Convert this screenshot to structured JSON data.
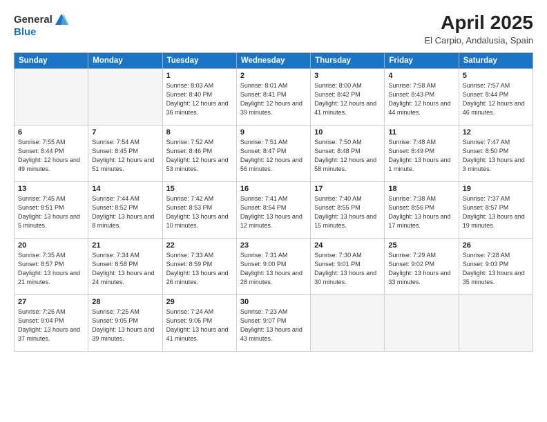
{
  "header": {
    "logo_general": "General",
    "logo_blue": "Blue",
    "title": "April 2025",
    "subtitle": "El Carpio, Andalusia, Spain"
  },
  "weekdays": [
    "Sunday",
    "Monday",
    "Tuesday",
    "Wednesday",
    "Thursday",
    "Friday",
    "Saturday"
  ],
  "weeks": [
    [
      {
        "day": "",
        "info": ""
      },
      {
        "day": "",
        "info": ""
      },
      {
        "day": "1",
        "info": "Sunrise: 8:03 AM\nSunset: 8:40 PM\nDaylight: 12 hours and 36 minutes."
      },
      {
        "day": "2",
        "info": "Sunrise: 8:01 AM\nSunset: 8:41 PM\nDaylight: 12 hours and 39 minutes."
      },
      {
        "day": "3",
        "info": "Sunrise: 8:00 AM\nSunset: 8:42 PM\nDaylight: 12 hours and 41 minutes."
      },
      {
        "day": "4",
        "info": "Sunrise: 7:58 AM\nSunset: 8:43 PM\nDaylight: 12 hours and 44 minutes."
      },
      {
        "day": "5",
        "info": "Sunrise: 7:57 AM\nSunset: 8:44 PM\nDaylight: 12 hours and 46 minutes."
      }
    ],
    [
      {
        "day": "6",
        "info": "Sunrise: 7:55 AM\nSunset: 8:44 PM\nDaylight: 12 hours and 49 minutes."
      },
      {
        "day": "7",
        "info": "Sunrise: 7:54 AM\nSunset: 8:45 PM\nDaylight: 12 hours and 51 minutes."
      },
      {
        "day": "8",
        "info": "Sunrise: 7:52 AM\nSunset: 8:46 PM\nDaylight: 12 hours and 53 minutes."
      },
      {
        "day": "9",
        "info": "Sunrise: 7:51 AM\nSunset: 8:47 PM\nDaylight: 12 hours and 56 minutes."
      },
      {
        "day": "10",
        "info": "Sunrise: 7:50 AM\nSunset: 8:48 PM\nDaylight: 12 hours and 58 minutes."
      },
      {
        "day": "11",
        "info": "Sunrise: 7:48 AM\nSunset: 8:49 PM\nDaylight: 13 hours and 1 minute."
      },
      {
        "day": "12",
        "info": "Sunrise: 7:47 AM\nSunset: 8:50 PM\nDaylight: 13 hours and 3 minutes."
      }
    ],
    [
      {
        "day": "13",
        "info": "Sunrise: 7:45 AM\nSunset: 8:51 PM\nDaylight: 13 hours and 5 minutes."
      },
      {
        "day": "14",
        "info": "Sunrise: 7:44 AM\nSunset: 8:52 PM\nDaylight: 13 hours and 8 minutes."
      },
      {
        "day": "15",
        "info": "Sunrise: 7:42 AM\nSunset: 8:53 PM\nDaylight: 13 hours and 10 minutes."
      },
      {
        "day": "16",
        "info": "Sunrise: 7:41 AM\nSunset: 8:54 PM\nDaylight: 13 hours and 12 minutes."
      },
      {
        "day": "17",
        "info": "Sunrise: 7:40 AM\nSunset: 8:55 PM\nDaylight: 13 hours and 15 minutes."
      },
      {
        "day": "18",
        "info": "Sunrise: 7:38 AM\nSunset: 8:56 PM\nDaylight: 13 hours and 17 minutes."
      },
      {
        "day": "19",
        "info": "Sunrise: 7:37 AM\nSunset: 8:57 PM\nDaylight: 13 hours and 19 minutes."
      }
    ],
    [
      {
        "day": "20",
        "info": "Sunrise: 7:35 AM\nSunset: 8:57 PM\nDaylight: 13 hours and 21 minutes."
      },
      {
        "day": "21",
        "info": "Sunrise: 7:34 AM\nSunset: 8:58 PM\nDaylight: 13 hours and 24 minutes."
      },
      {
        "day": "22",
        "info": "Sunrise: 7:33 AM\nSunset: 8:59 PM\nDaylight: 13 hours and 26 minutes."
      },
      {
        "day": "23",
        "info": "Sunrise: 7:31 AM\nSunset: 9:00 PM\nDaylight: 13 hours and 28 minutes."
      },
      {
        "day": "24",
        "info": "Sunrise: 7:30 AM\nSunset: 9:01 PM\nDaylight: 13 hours and 30 minutes."
      },
      {
        "day": "25",
        "info": "Sunrise: 7:29 AM\nSunset: 9:02 PM\nDaylight: 13 hours and 33 minutes."
      },
      {
        "day": "26",
        "info": "Sunrise: 7:28 AM\nSunset: 9:03 PM\nDaylight: 13 hours and 35 minutes."
      }
    ],
    [
      {
        "day": "27",
        "info": "Sunrise: 7:26 AM\nSunset: 9:04 PM\nDaylight: 13 hours and 37 minutes."
      },
      {
        "day": "28",
        "info": "Sunrise: 7:25 AM\nSunset: 9:05 PM\nDaylight: 13 hours and 39 minutes."
      },
      {
        "day": "29",
        "info": "Sunrise: 7:24 AM\nSunset: 9:06 PM\nDaylight: 13 hours and 41 minutes."
      },
      {
        "day": "30",
        "info": "Sunrise: 7:23 AM\nSunset: 9:07 PM\nDaylight: 13 hours and 43 minutes."
      },
      {
        "day": "",
        "info": ""
      },
      {
        "day": "",
        "info": ""
      },
      {
        "day": "",
        "info": ""
      }
    ]
  ]
}
